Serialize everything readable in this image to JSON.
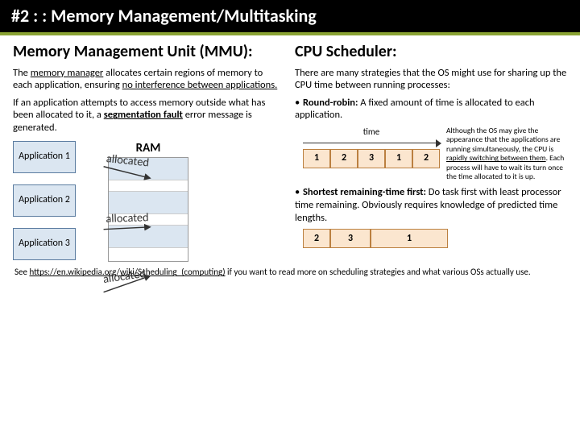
{
  "title": "#2 : : Memory Management/Multitasking",
  "left": {
    "heading": "Memory Management Unit (MMU):",
    "p1a": "The ",
    "p1b": "memory manager",
    "p1c": " allocates certain regions of memory to each application, ensuring ",
    "p1d": "no interference between applications.",
    "p2a": "If an application attempts to access memory outside what has been allocated to it, a ",
    "p2b": "segmentation fault",
    "p2c": " error message is generated.",
    "apps": [
      "Application 1",
      "Application 2",
      "Application 3"
    ],
    "ram_label": "RAM",
    "allocated_label": "allocated"
  },
  "right": {
    "heading": "CPU Scheduler:",
    "intro": "There are many strategies that the OS might use for sharing up the CPU time between running processes:",
    "rr_lead": "Round-robin:",
    "rr_rest": " A fixed amount of time is allocated to each application.",
    "time_label": "time",
    "rr_cells": [
      "1",
      "2",
      "3",
      "1",
      "2"
    ],
    "aside_a": "Although the OS may give the appearance that the applications are running simultaneously, the CPU is ",
    "aside_b": "rapidly switching between them",
    "aside_c": ". Each process will have to wait its turn once the time allocated to it is up.",
    "srt_lead": "Shortest remaining-time first:",
    "srt_rest": " Do task first with least processor time remaining. Obviously requires knowledge of predicted time lengths.",
    "srt_cells": [
      "2",
      "3",
      "1"
    ]
  },
  "footer_a": "See ",
  "footer_link": "https://en.wikipedia.org/wiki/Scheduling_(computing)",
  "footer_b": " if you want to read more on scheduling strategies and what various OSs actually use."
}
